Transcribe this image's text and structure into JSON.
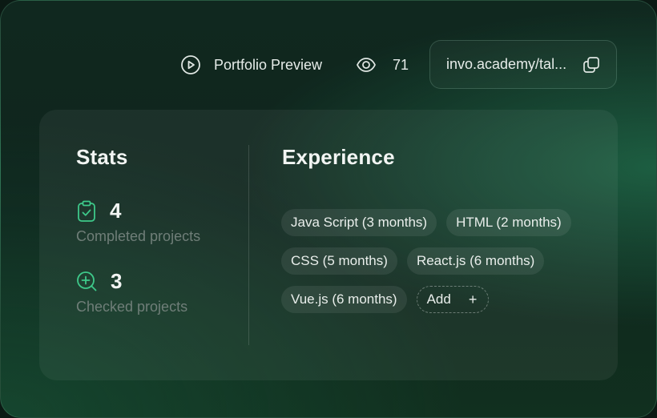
{
  "topbar": {
    "preview_label": "Portfolio Preview",
    "views_count": "71",
    "url": "invo.academy/tal..."
  },
  "stats": {
    "title": "Stats",
    "items": [
      {
        "value": "4",
        "label": "Completed projects",
        "icon": "clipboard-check-icon"
      },
      {
        "value": "3",
        "label": "Checked projects",
        "icon": "search-plus-icon"
      }
    ]
  },
  "experience": {
    "title": "Experience",
    "tags": [
      "Java Script (3 months)",
      "HTML (2 months)",
      "CSS (5 months)",
      "React.js (6 months)",
      "Vue.js (6 months)"
    ],
    "add_label": "Add",
    "add_symbol": "+"
  },
  "colors": {
    "accent": "#3ec98a",
    "background": "#10281f",
    "muted_text": "#6f7e78"
  }
}
